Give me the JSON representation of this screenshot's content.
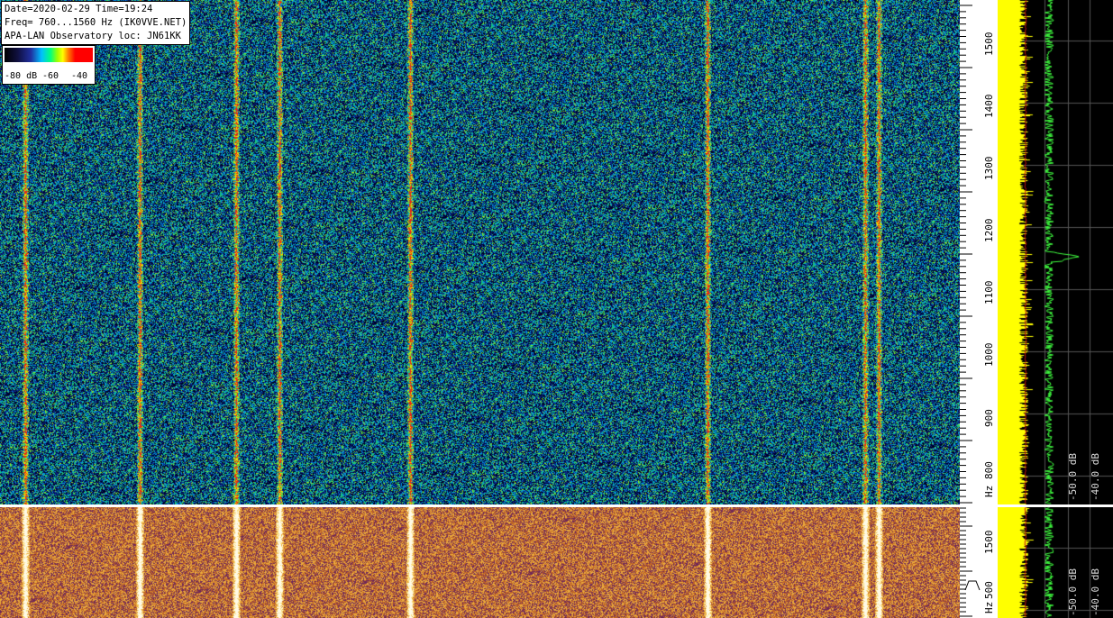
{
  "header": {
    "line1": "Date=2020-02-29 Time=19:24",
    "line2": "Freq= 760...1560 Hz (IK0VVE.NET)",
    "line3": "APA-LAN Observatory loc: JN61KK"
  },
  "legend": {
    "label_min": "-80 dB",
    "label_mid": "-60",
    "label_max": "-40"
  },
  "top_axis": {
    "unit": "Hz",
    "ticks": [
      "800",
      "900",
      "1000",
      "1100",
      "1200",
      "1300",
      "1400",
      "1500"
    ]
  },
  "bottom_axis": {
    "unit": "Hz",
    "ticks": [
      "500",
      "1500"
    ]
  },
  "spectrum_top": {
    "label_a": "-50.0 dB",
    "label_b": "-40.0 dB"
  },
  "spectrum_bottom": {
    "label_a": "-50.0 dB",
    "label_b": "-40.0 dB"
  },
  "colors": {
    "top_background": "#1a3a8a",
    "bottom_background": "#c87a28",
    "spectrum_fill": "#ffff00",
    "spectrum_trace": "#40ff40"
  }
}
